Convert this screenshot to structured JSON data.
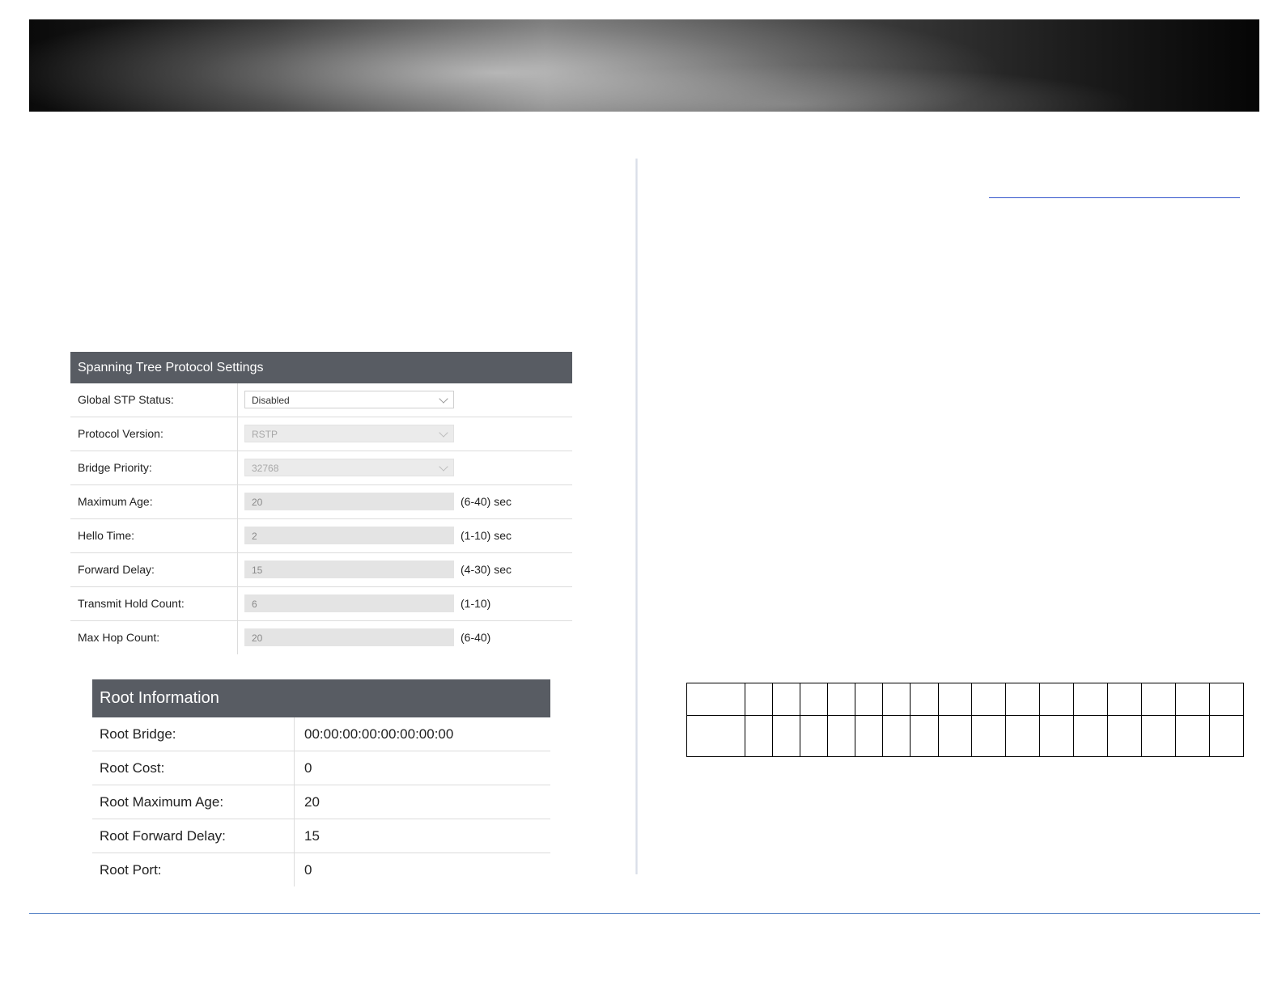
{
  "stp": {
    "title": "Spanning Tree Protocol Settings",
    "rows": [
      {
        "label": "Global STP Status:",
        "value": "Disabled",
        "range": ""
      },
      {
        "label": "Protocol Version:",
        "value": "RSTP",
        "range": ""
      },
      {
        "label": "Bridge Priority:",
        "value": "32768",
        "range": ""
      },
      {
        "label": "Maximum Age:",
        "value": "20",
        "range": "(6-40) sec"
      },
      {
        "label": "Hello Time:",
        "value": "2",
        "range": "(1-10) sec"
      },
      {
        "label": "Forward Delay:",
        "value": "15",
        "range": "(4-30) sec"
      },
      {
        "label": "Transmit Hold Count:",
        "value": "6",
        "range": "(1-10)"
      },
      {
        "label": "Max Hop Count:",
        "value": "20",
        "range": "(6-40)"
      }
    ]
  },
  "root": {
    "title": "Root Information",
    "rows": [
      {
        "label": "Root Bridge:",
        "value": "00:00:00:00:00:00:00:00"
      },
      {
        "label": "Root Cost:",
        "value": "0"
      },
      {
        "label": "Root Maximum Age:",
        "value": "20"
      },
      {
        "label": "Root Forward Delay:",
        "value": "15"
      },
      {
        "label": "Root Port:",
        "value": "0"
      }
    ]
  },
  "colors": {
    "panel_header": "#585c63",
    "divider_line": "#5b87c8",
    "link": "#3355cc"
  }
}
